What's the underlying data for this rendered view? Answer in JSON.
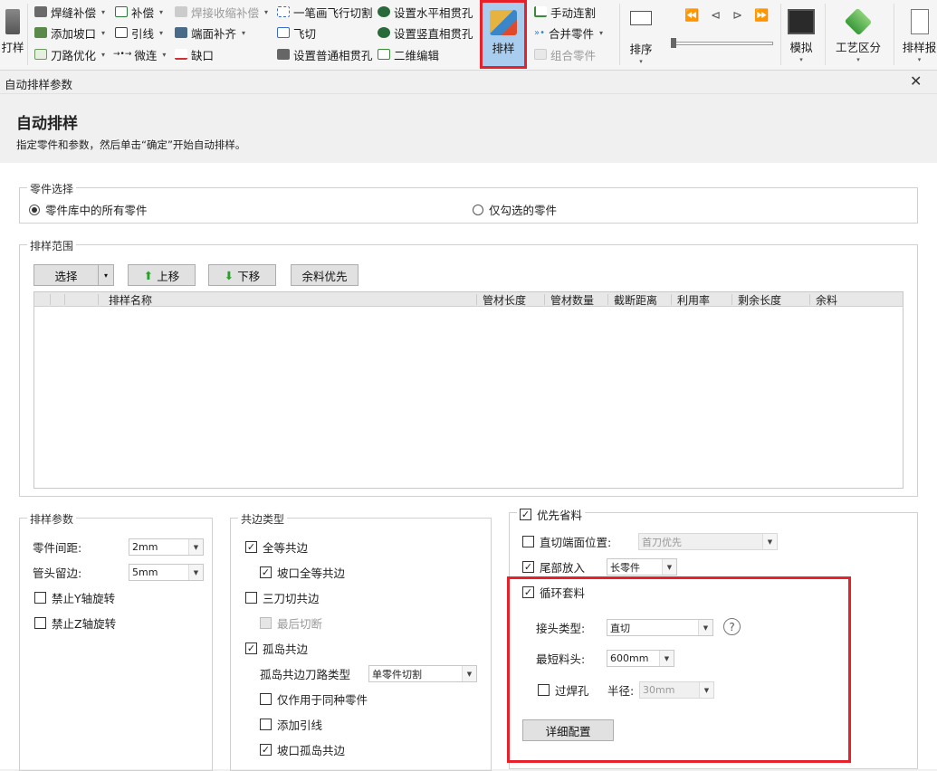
{
  "ribbon": {
    "col0": {
      "label": "打样"
    },
    "group1": [
      {
        "label": "焊缝补偿",
        "icon": "weld-comp-icon",
        "disabled": false
      },
      {
        "label": "添加坡口",
        "icon": "bevel-icon",
        "disabled": false
      },
      {
        "label": "刀路优化",
        "icon": "toolpath-icon",
        "disabled": false
      }
    ],
    "group2": [
      {
        "label": "补偿",
        "icon": "compensation-icon"
      },
      {
        "label": "引线",
        "icon": "lead-line-icon"
      },
      {
        "label": "微连",
        "icon": "micro-joint-icon"
      }
    ],
    "group3": [
      {
        "label": "焊接收缩补偿",
        "disabled": true
      },
      {
        "label": "端面补齐"
      },
      {
        "label": "缺口"
      }
    ],
    "group4": [
      {
        "label": "一笔画飞行切割"
      },
      {
        "label": "飞切"
      },
      {
        "label": "设置普通相贯孔"
      }
    ],
    "group5": [
      {
        "label": "设置水平相贯孔"
      },
      {
        "label": "设置竖直相贯孔"
      },
      {
        "label": "二维编辑"
      }
    ],
    "nesting": {
      "label": "排样"
    },
    "group6": [
      {
        "label": "手动连割",
        "disabled": false
      },
      {
        "label": "合并零件",
        "disabled": false
      },
      {
        "label": "组合零件",
        "disabled": true
      }
    ],
    "sort": {
      "label": "排序"
    },
    "simulate": {
      "label": "模拟"
    },
    "process": {
      "label": "工艺区分"
    },
    "report": {
      "label": "排样报"
    }
  },
  "dialog": {
    "window_title": "自动排样参数",
    "heading": "自动排样",
    "instruction": "指定零件和参数，然后单击“确定”开始自动排样。",
    "parts_group": {
      "legend": "零件选择",
      "option_all": "零件库中的所有零件",
      "option_checked": "仅勾选的零件",
      "selected": "all"
    },
    "range_group": {
      "legend": "排样范围",
      "select_btn": "选择",
      "up_btn": "上移",
      "down_btn": "下移",
      "remnant_btn": "余料优先",
      "columns": [
        "排样名称",
        "管材长度",
        "管材数量",
        "截断距离",
        "利用率",
        "剩余长度",
        "余料"
      ]
    },
    "params_group": {
      "legend": "排样参数",
      "spacing_label": "零件间距:",
      "spacing_value": "2mm",
      "margin_label": "管头留边:",
      "margin_value": "5mm",
      "no_y_rotate": "禁止Y轴旋转",
      "no_z_rotate": "禁止Z轴旋转"
    },
    "common_group": {
      "legend": "共边类型",
      "full_common": "全等共边",
      "bevel_full_common": "坡口全等共边",
      "three_cut_common": "三刀切共边",
      "last_cut": "最后切断",
      "island_common": "孤岛共边",
      "island_path_label": "孤岛共边刀路类型",
      "island_path_value": "单零件切割",
      "same_part_only": "仅作用于同种零件",
      "add_lead": "添加引线",
      "bevel_island": "坡口孤岛共边"
    },
    "priority_group": {
      "legend": "优先省料",
      "straight_end_label": "直切端面位置:",
      "straight_end_value": "首刀优先",
      "tail_put_label": "尾部放入",
      "tail_put_value": "长零件",
      "loop_nest": "循环套料",
      "joint_type_label": "接头类型:",
      "joint_type_value": "直切",
      "min_head_label": "最短料头:",
      "min_head_value": "600mm",
      "weld_hole": "过焊孔",
      "radius_label": "半径:",
      "radius_value": "30mm",
      "detail_btn": "详细配置"
    }
  },
  "colors": {
    "highlight": "#e8202a",
    "nesting_bg": "#a9cdee"
  }
}
